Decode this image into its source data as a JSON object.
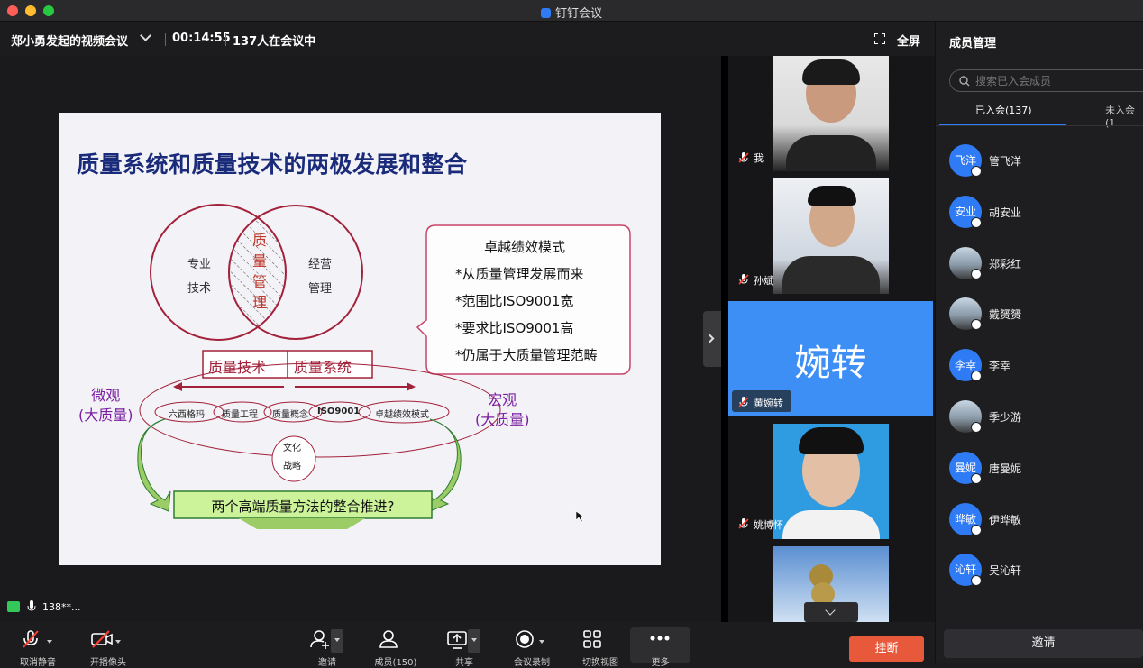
{
  "window": {
    "title": "钉钉会议"
  },
  "meeting": {
    "title": "郑小勇发起的视频会议",
    "elapsed": "00:14:55",
    "participants": "137人在会议中",
    "fullscreen_label": "全屏"
  },
  "slide": {
    "title": "质量系统和质量技术的两极发展和整合",
    "venn_left": [
      "专业",
      "技术"
    ],
    "venn_center": [
      "质",
      "量",
      "管",
      "理"
    ],
    "venn_right": [
      "经营",
      "管理"
    ],
    "callout_lines": [
      "卓越绩效模式",
      "*从质量管理发展而来",
      "*范围比ISO9001宽",
      "*要求比ISO9001高",
      "*仍属于大质量管理范畴"
    ],
    "box_left": "质量技术",
    "box_right": "质量系统",
    "micro": [
      "微观",
      "(大质量)"
    ],
    "macro": [
      "宏观",
      "(大质量)"
    ],
    "chain": [
      "六西格玛",
      "质量工程",
      "质量概念",
      "ISO9001",
      "卓越绩效模式"
    ],
    "culture": [
      "文化",
      "战略"
    ],
    "bottom_box": "两个高端质量方法的整合推进?"
  },
  "videos": [
    {
      "name": "我"
    },
    {
      "name": "孙斌"
    },
    {
      "name": "黄婉转",
      "avatar_text": "婉转"
    },
    {
      "name": "姚博怀"
    }
  ],
  "speaking": {
    "text": "138**..."
  },
  "panel": {
    "title": "成员管理",
    "search_placeholder": "搜索已入会成员",
    "tab_joined": "已入会(137)",
    "tab_not_joined": "未入会(1",
    "members": [
      {
        "avatar": "飞洋",
        "name": "管飞洋",
        "photo": false
      },
      {
        "avatar": "安业",
        "name": "胡安业",
        "photo": false
      },
      {
        "avatar": "",
        "name": "郑彩红",
        "photo": true
      },
      {
        "avatar": "",
        "name": "戴赟赟",
        "photo": true
      },
      {
        "avatar": "李幸",
        "name": "李幸",
        "photo": false
      },
      {
        "avatar": "",
        "name": "季少游",
        "photo": true
      },
      {
        "avatar": "曼妮",
        "name": "唐曼妮",
        "photo": false
      },
      {
        "avatar": "晔敏",
        "name": "伊晔敏",
        "photo": false
      },
      {
        "avatar": "沁轩",
        "name": "吴沁轩",
        "photo": false
      }
    ],
    "invite_label": "邀请"
  },
  "toolbar": {
    "unmute": "取消静音",
    "camera": "开播像头",
    "invite": "邀请",
    "members": "成员(150)",
    "share": "共享",
    "record": "会议录制",
    "switch_view": "切换视图",
    "more": "更多",
    "hangup": "挂断"
  },
  "colors": {
    "accent": "#2f7bf5",
    "hangup": "#e8583a",
    "slide_title": "#1a2b7a",
    "venn_red": "#a3213a"
  }
}
